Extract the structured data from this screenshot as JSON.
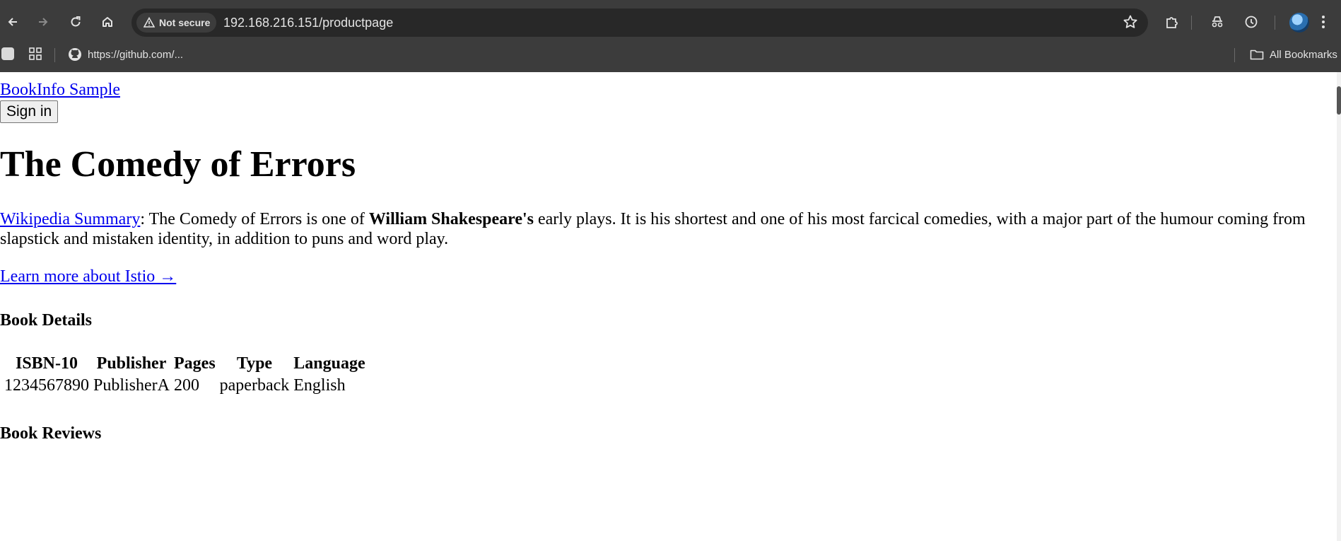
{
  "browser": {
    "security_label": "Not secure",
    "url": "192.168.216.151/productpage",
    "bookmarks": [
      {
        "label": "https://github.com/...",
        "icon": "github-icon"
      }
    ],
    "all_bookmarks_label": "All Bookmarks"
  },
  "page": {
    "brand_link": "BookInfo Sample",
    "sign_in_label": "Sign in",
    "title": "The Comedy of Errors",
    "summary": {
      "link": "Wikipedia Summary",
      "text_before": ": The Comedy of Errors is one of ",
      "bold": "William Shakespeare's",
      "text_after": " early plays. It is his shortest and one of his most farcical comedies, with a major part of the humour coming from slapstick and mistaken identity, in addition to puns and word play."
    },
    "learn_more": "Learn more about Istio →",
    "details": {
      "heading": "Book Details",
      "headers": [
        "ISBN-10",
        "Publisher",
        "Pages",
        "Type",
        "Language"
      ],
      "row": [
        "1234567890",
        "PublisherA",
        "200",
        "paperback",
        "English"
      ]
    },
    "reviews": {
      "heading": "Book Reviews"
    }
  }
}
